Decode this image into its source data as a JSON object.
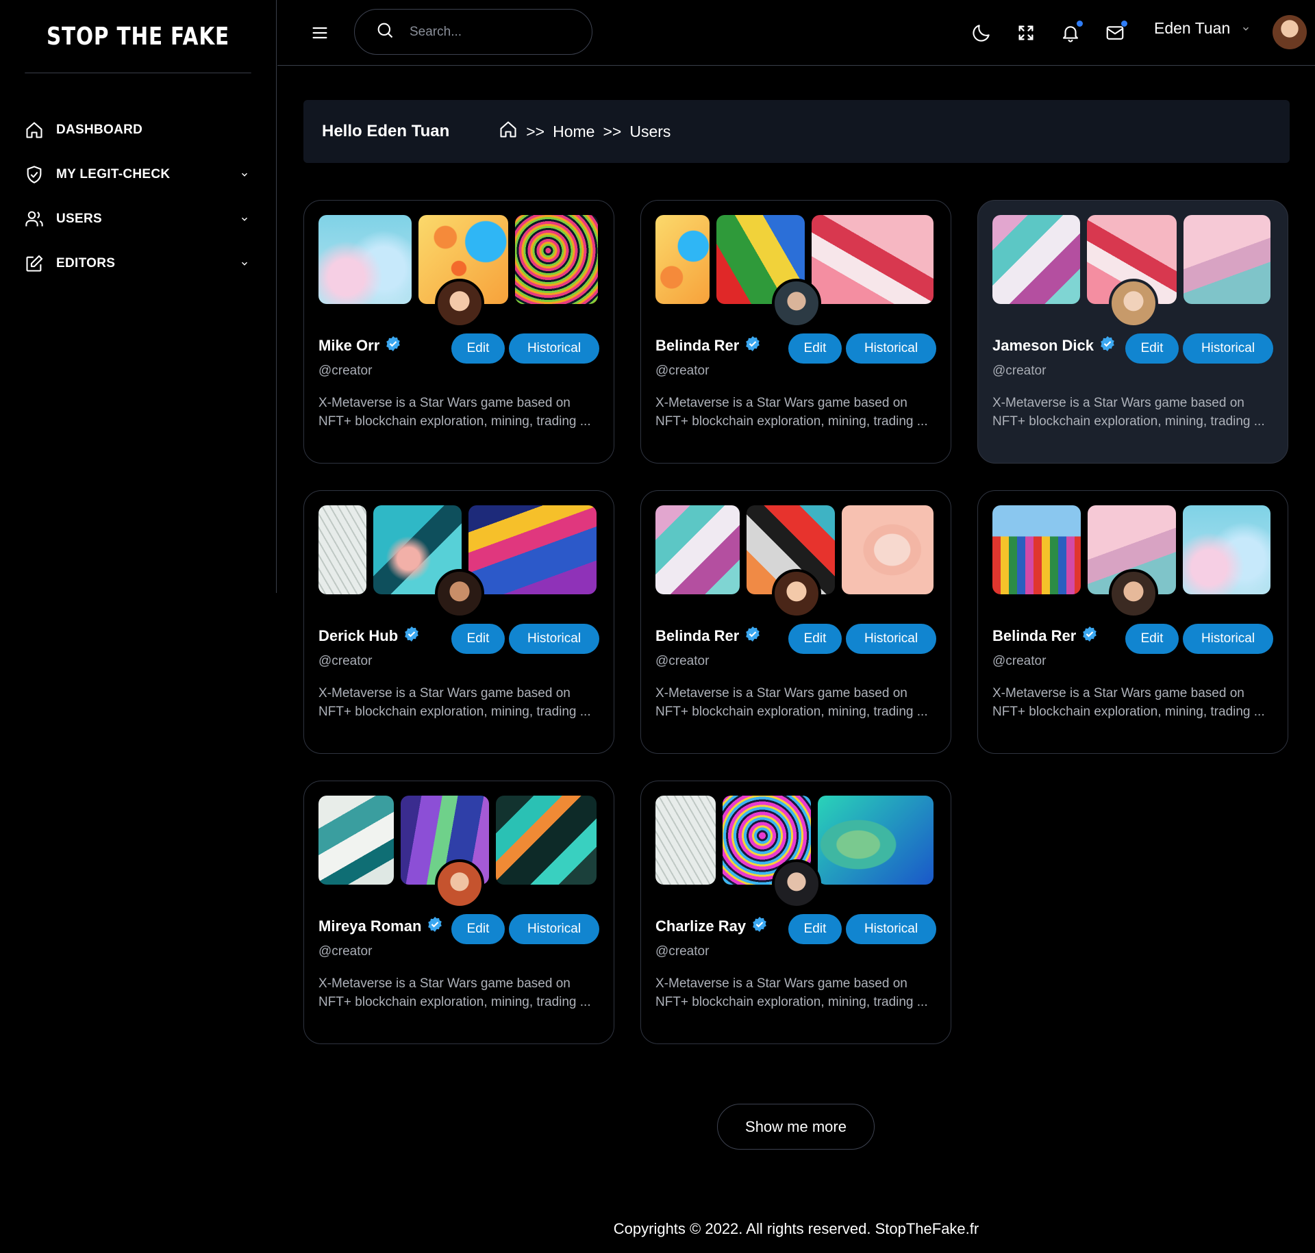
{
  "brand": "STOP THE FAKE",
  "sidebar": {
    "items": [
      {
        "label": "DASHBOARD",
        "icon": "home-icon",
        "has_chevron": false
      },
      {
        "label": "MY LEGIT-CHECK",
        "icon": "shield-check-icon",
        "has_chevron": true
      },
      {
        "label": "USERS",
        "icon": "users-icon",
        "has_chevron": true
      },
      {
        "label": "EDITORS",
        "icon": "edit-icon",
        "has_chevron": true
      }
    ]
  },
  "topbar": {
    "search_placeholder": "Search...",
    "user_name": "Eden Tuan",
    "icons": [
      "moon-icon",
      "fullscreen-icon",
      "bell-icon",
      "mail-icon"
    ]
  },
  "banner": {
    "greeting": "Hello Eden Tuan",
    "breadcrumb": [
      "Home",
      "Users"
    ],
    "separator": ">>"
  },
  "cards": [
    {
      "name": "Mike Orr",
      "handle": "@creator",
      "desc": "X-Metaverse is a Star Wars game based on NFT+ blockchain exploration, mining, trading ...",
      "edit": "Edit",
      "historical": "Historical"
    },
    {
      "name": "Belinda Rer",
      "handle": "@creator",
      "desc": "X-Metaverse is a Star Wars game based on NFT+ blockchain exploration, mining, trading ...",
      "edit": "Edit",
      "historical": "Historical"
    },
    {
      "name": "Jameson Dick",
      "handle": "@creator",
      "desc": "X-Metaverse is a Star Wars game based on NFT+ blockchain exploration, mining, trading ...",
      "edit": "Edit",
      "historical": "Historical"
    },
    {
      "name": "Derick Hub",
      "handle": "@creator",
      "desc": "X-Metaverse is a Star Wars game based on NFT+ blockchain exploration, mining, trading ...",
      "edit": "Edit",
      "historical": "Historical"
    },
    {
      "name": "Belinda Rer",
      "handle": "@creator",
      "desc": "X-Metaverse is a Star Wars game based on NFT+ blockchain exploration, mining, trading ...",
      "edit": "Edit",
      "historical": "Historical"
    },
    {
      "name": "Belinda Rer",
      "handle": "@creator",
      "desc": "X-Metaverse is a Star Wars game based on NFT+ blockchain exploration, mining, trading ...",
      "edit": "Edit",
      "historical": "Historical"
    },
    {
      "name": "Mireya Roman",
      "handle": "@creator",
      "desc": "X-Metaverse is a Star Wars game based on NFT+ blockchain exploration, mining, trading ...",
      "edit": "Edit",
      "historical": "Historical"
    },
    {
      "name": "Charlize Ray",
      "handle": "@creator",
      "desc": "X-Metaverse is a Star Wars game based on NFT+ blockchain exploration, mining, trading ...",
      "edit": "Edit",
      "historical": "Historical"
    }
  ],
  "show_more": "Show me more",
  "footer": "Copyrights © 2022. All rights reserved. StopTheFake.fr",
  "colors": {
    "accent": "#1185d0",
    "verified": "#3ba7f0",
    "notification_dot": "#2f7df6"
  }
}
